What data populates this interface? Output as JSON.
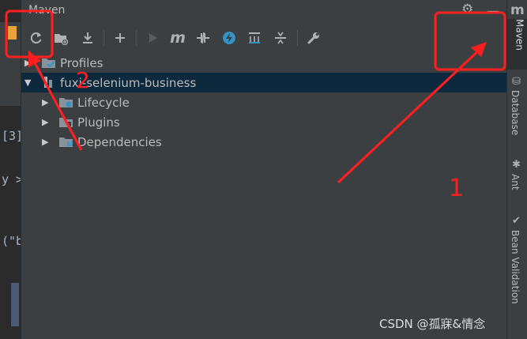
{
  "window": {
    "title": "Maven"
  },
  "toolbar": {
    "buttons": [
      {
        "icon": "reload-icon"
      },
      {
        "icon": "add-folder-icon"
      },
      {
        "icon": "download-icon"
      },
      {
        "icon": "plus-icon"
      },
      {
        "icon": "run-icon"
      },
      {
        "icon": "maven-goal-icon"
      },
      {
        "icon": "toggle-offline-icon"
      },
      {
        "icon": "skip-tests-icon"
      },
      {
        "icon": "show-dependencies-icon"
      },
      {
        "icon": "collapse-all-icon"
      },
      {
        "icon": "settings-wrench-icon"
      }
    ]
  },
  "tree": {
    "items": [
      {
        "label": "Profiles"
      },
      {
        "label": "fuxi-selenium-business"
      },
      {
        "label": "Lifecycle"
      },
      {
        "label": "Plugins"
      },
      {
        "label": "Dependencies"
      }
    ]
  },
  "editor": {
    "lines": [
      "[3]",
      "y >",
      "(\"b"
    ]
  },
  "sidebar": {
    "logo": "m",
    "tabs": [
      {
        "label": "Maven"
      },
      {
        "label": "Database"
      },
      {
        "label": "Ant"
      },
      {
        "label": "Bean Validation"
      }
    ]
  },
  "annotations": {
    "label1": "1",
    "label2": "2",
    "color": "#ff1f1f"
  },
  "watermark": "CSDN @孤寐&情念"
}
